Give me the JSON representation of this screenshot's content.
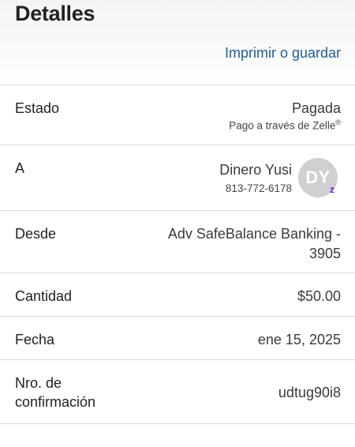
{
  "header": {
    "title": "Detalles",
    "print_link": "Imprimir o guardar"
  },
  "status": {
    "label": "Estado",
    "value": "Pagada",
    "sub": "Pago a través de Zelle",
    "sub_mark": "®"
  },
  "to": {
    "label": "A",
    "name": "Dinero Yusi",
    "phone": "813-772-6178",
    "avatar_initials": "DY",
    "badge_icon": "zelle-z"
  },
  "from": {
    "label": "Desde",
    "value_line1": "Adv SafeBalance Banking -",
    "value_line2": "3905"
  },
  "amount": {
    "label": "Cantidad",
    "value": "$50.00"
  },
  "date": {
    "label": "Fecha",
    "value": "ene 15, 2025"
  },
  "confirmation": {
    "label_line1": "Nro. de",
    "label_line2": "confirmación",
    "value": "udtug90i8"
  },
  "colors": {
    "link": "#1f5c92",
    "zelle": "#6d1ed4",
    "avatar_bg": "#d0d0d0"
  }
}
